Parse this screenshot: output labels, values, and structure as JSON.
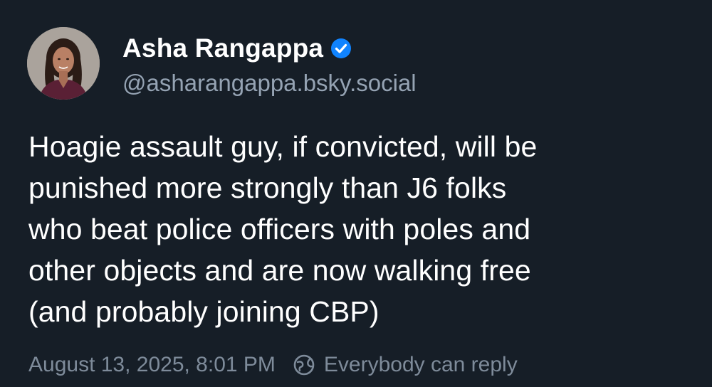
{
  "post": {
    "author": {
      "display_name": "Asha Rangappa",
      "handle": "@asharangappa.bsky.social",
      "verified": true,
      "avatar_icon": "profile-photo",
      "verified_icon": "verified-check-icon",
      "verified_color": "#1083fe"
    },
    "text": "Hoagie assault guy, if convicted, will be\npunished more strongly than J6 folks\nwho beat police officers with poles and\nother objects and are now walking free\n(and probably joining CBP)",
    "timestamp": "August 13, 2025, 8:01 PM",
    "reply_setting": "Everybody can reply",
    "reply_icon": "globe-icon"
  },
  "colors": {
    "background": "#161e27",
    "text_primary": "#ffffff",
    "text_secondary": "#95a3b3",
    "text_meta": "#7e8b9a"
  }
}
